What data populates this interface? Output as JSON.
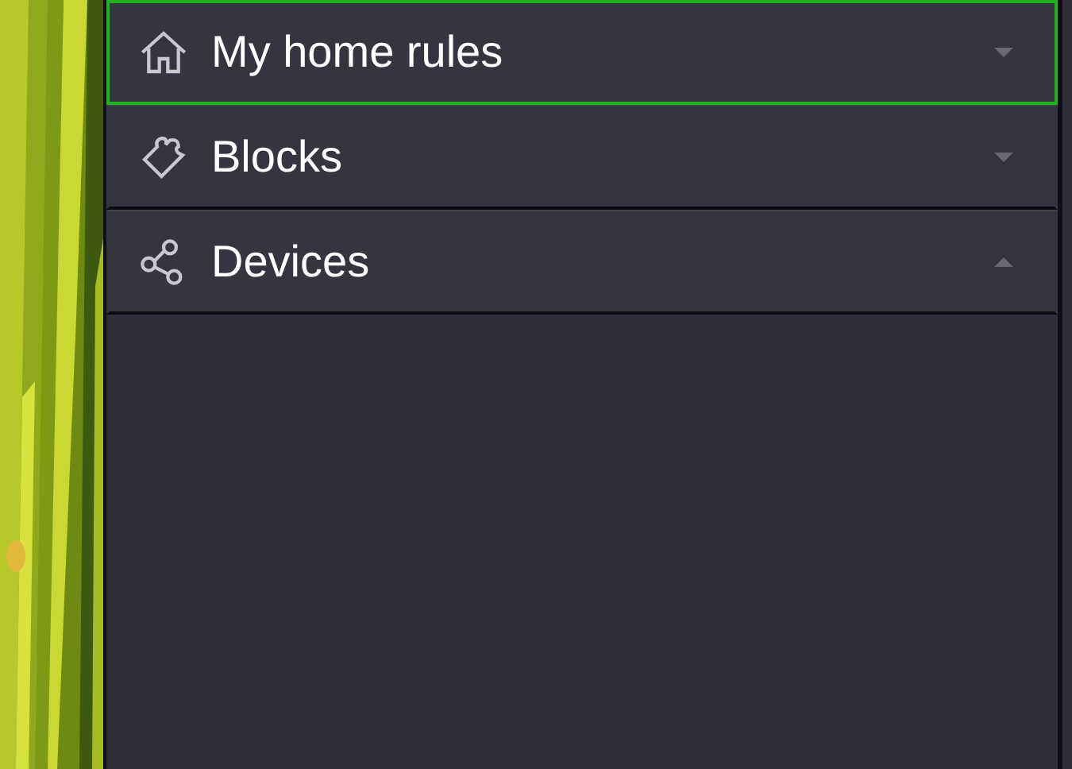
{
  "sidebar": {
    "items": [
      {
        "label": "My home rules",
        "selected": true,
        "expanded": false
      },
      {
        "label": "Blocks",
        "selected": false,
        "expanded": false
      },
      {
        "label": "Devices",
        "selected": false,
        "expanded": true
      }
    ]
  }
}
